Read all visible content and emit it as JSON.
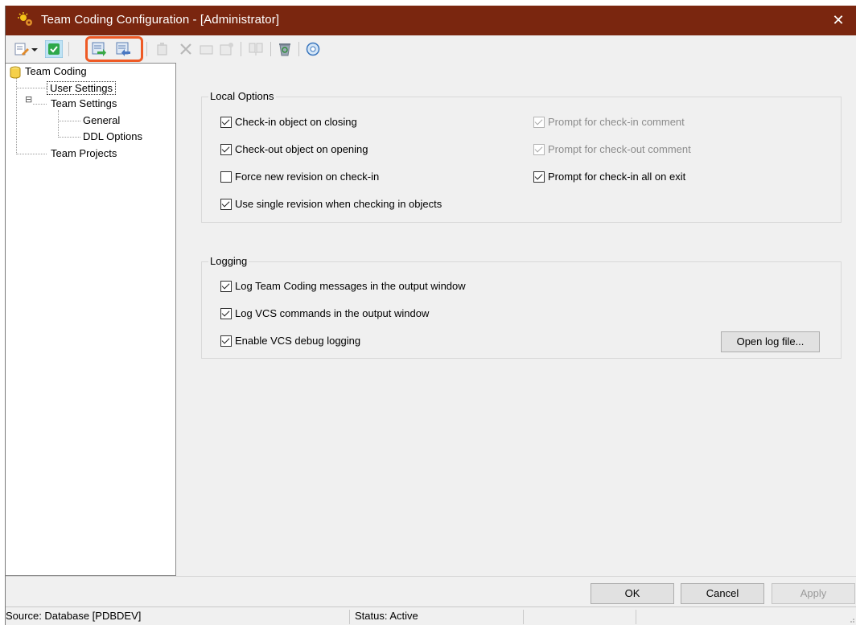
{
  "window": {
    "title": "Team Coding Configuration - [Administrator]",
    "close_glyph": "✕"
  },
  "toolbar": {
    "icons": [
      "edit-dropdown-icon",
      "dropdown-arrow-icon",
      "green-check-icon",
      "check-in-icon",
      "check-out-icon",
      "add-icon",
      "delete-icon",
      "folder-icon",
      "properties-icon",
      "compare-icon",
      "recycle-icon",
      "help-icon"
    ]
  },
  "tree": {
    "root": "Team Coding",
    "user_settings": "User Settings",
    "team_settings": "Team Settings",
    "expander": "⊟",
    "general": "General",
    "ddl_options": "DDL Options",
    "team_projects": "Team Projects"
  },
  "local_options": {
    "title": "Local Options",
    "checkin_on_closing": {
      "label": "Check-in object on closing",
      "checked": true
    },
    "checkout_on_opening": {
      "label": "Check-out object on opening",
      "checked": true
    },
    "force_new_revision": {
      "label": "Force new revision on check-in",
      "checked": false
    },
    "single_revision": {
      "label": "Use single revision when checking in objects",
      "checked": true
    },
    "prompt_checkin_comment": {
      "label": "Prompt for check-in comment",
      "checked": true,
      "enabled": false
    },
    "prompt_checkout_comment": {
      "label": "Prompt for check-out comment",
      "checked": true,
      "enabled": false
    },
    "prompt_checkin_all_exit": {
      "label": "Prompt for check-in all on exit",
      "checked": true
    }
  },
  "logging": {
    "title": "Logging",
    "log_team_coding": {
      "label": "Log Team Coding messages in the output window",
      "checked": true
    },
    "log_vcs_commands": {
      "label": "Log VCS commands in the output window",
      "checked": true
    },
    "enable_vcs_debug": {
      "label": "Enable VCS debug logging",
      "checked": true
    },
    "open_log_button": "Open log file..."
  },
  "buttons": {
    "ok": "OK",
    "cancel": "Cancel",
    "apply": "Apply"
  },
  "status": {
    "source": "Source: Database [PDBDEV]",
    "state": "Status: Active"
  },
  "colors": {
    "titlebar": "#7a260f",
    "highlight": "#ee5a25"
  }
}
